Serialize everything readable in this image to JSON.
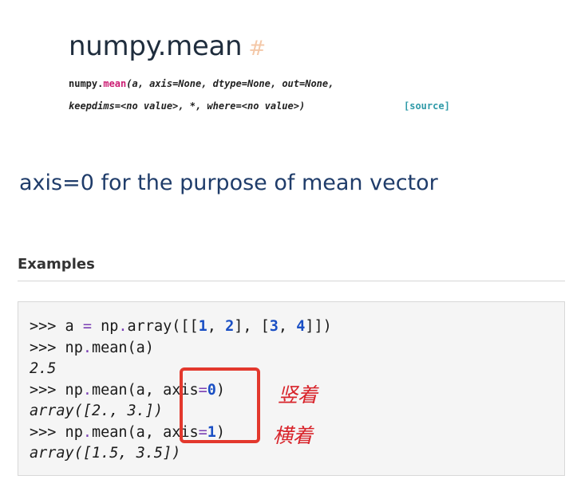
{
  "doc": {
    "title": "numpy.mean",
    "hash": "#",
    "signature": {
      "prefix": "numpy.",
      "function": "mean",
      "line1_rest": "(a, axis=None, dtype=None, out=None,",
      "line2": "keepdims=<no value>, *, where=<no value>)",
      "source_link": "[source]"
    }
  },
  "caption": "axis=0 for the purpose of mean vector",
  "examples": {
    "heading": "Examples",
    "code": {
      "l1": {
        "prompt": ">>>",
        "p1": " a ",
        "eq": "=",
        "p2": " np",
        "dot": ".",
        "p3": "array([[",
        "n1": "1",
        "c1": ", ",
        "n2": "2",
        "c2": "], [",
        "n3": "3",
        "c3": ", ",
        "n4": "4",
        "c4": "]])"
      },
      "l2": {
        "prompt": ">>>",
        "p1": " np",
        "dot": ".",
        "p2": "mean(a)"
      },
      "l3": "2.5",
      "l4": {
        "prompt": ">>>",
        "p1": " np",
        "dot": ".",
        "p2": "mean(a, axis",
        "eq": "=",
        "n": "0",
        "p3": ")"
      },
      "l5": "array([2., 3.])",
      "l6": {
        "prompt": ">>>",
        "p1": " np",
        "dot": ".",
        "p2": "mean(a, axis",
        "eq": "=",
        "n": "1",
        "p3": ")"
      },
      "l7": "array([1.5, 3.5])"
    }
  },
  "annotations": {
    "note_axis0": "竖着",
    "note_axis1": "横着"
  }
}
